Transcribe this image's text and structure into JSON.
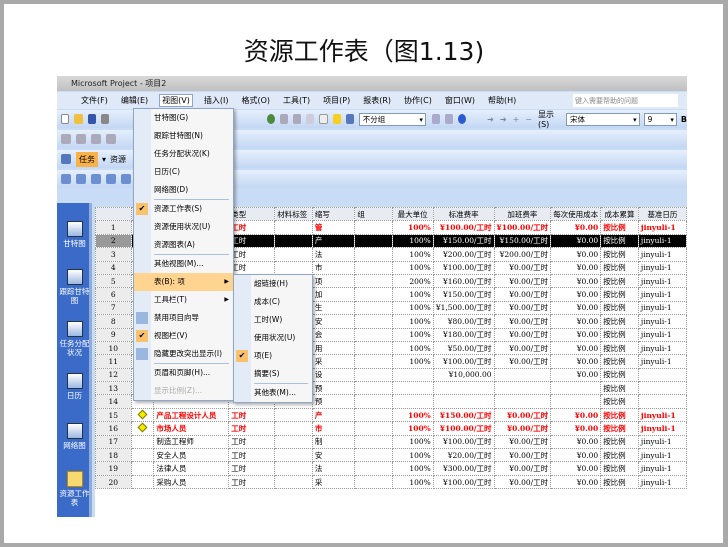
{
  "slide_title": "资源工作表（图1.13)",
  "app": {
    "title": "Microsoft Project - 项目2",
    "help_placeholder": "键入需要帮助的问题"
  },
  "menubar": [
    "文件(F)",
    "编辑(E)",
    "视图(V)",
    "插入(I)",
    "格式(O)",
    "工具(T)",
    "项目(P)",
    "报表(R)",
    "协作(C)",
    "窗口(W)",
    "帮助(H)"
  ],
  "toolbar": {
    "group": "不分组",
    "show": "显示(S)",
    "font": "宋体",
    "size": "9",
    "bold": "B",
    "task": "任务",
    "resource": "资源"
  },
  "viewbar": [
    "甘特图",
    "跟踪甘特图",
    "任务分配状况",
    "日历",
    "网络图",
    "资源工作表"
  ],
  "view_menu": [
    {
      "label": "甘特图(G)"
    },
    {
      "label": "跟踪甘特图(N)"
    },
    {
      "label": "任务分配状况(K)"
    },
    {
      "label": "日历(C)"
    },
    {
      "label": "网络图(D)",
      "sep": true
    },
    {
      "label": "资源工作表(S)",
      "checked": true
    },
    {
      "label": "资源使用状况(U)"
    },
    {
      "label": "资源图表(A)",
      "sep": true
    },
    {
      "label": "其他视图(M)..."
    },
    {
      "label": "表(B): 项",
      "submenu": true,
      "highlight": true
    },
    {
      "label": "工具栏(T)",
      "submenu": true
    },
    {
      "label": "禁用项目向导",
      "icon": true
    },
    {
      "label": "视图栏(V)",
      "checked": true
    },
    {
      "label": "隐藏更改突出显示(I)",
      "icon": true,
      "sep": true
    },
    {
      "label": "页眉和页脚(H)..."
    },
    {
      "label": "显示比例(Z)...",
      "disabled": true
    }
  ],
  "table_submenu": [
    {
      "label": "超链接(H)"
    },
    {
      "label": "成本(C)"
    },
    {
      "label": "工时(W)"
    },
    {
      "label": "使用状况(U)"
    },
    {
      "label": "项(E)",
      "checked": true
    },
    {
      "label": "摘要(S)",
      "sep": true
    },
    {
      "label": "其他表(M)..."
    }
  ],
  "columns": [
    "",
    "",
    "",
    "类型",
    "材料标签",
    "缩写",
    "组",
    "最大单位",
    "标准费率",
    "加班费率",
    "每次使用成本",
    "成本累算",
    "基准日历"
  ],
  "rows": [
    [
      "1",
      "",
      "",
      "工时",
      "",
      "管",
      "",
      "100%",
      "¥100.00/工时",
      "¥100.00/工时",
      "¥0.00",
      "按比例",
      "jinyuli-1"
    ],
    [
      "2",
      "",
      "",
      "工时",
      "",
      "产",
      "",
      "100%",
      "¥150.00/工时",
      "¥150.00/工时",
      "¥0.00",
      "按比例",
      "jinyuli-1"
    ],
    [
      "3",
      "",
      "",
      "工时",
      "",
      "法",
      "",
      "100%",
      "¥200.00/工时",
      "¥200.00/工时",
      "¥0.00",
      "按比例",
      "jinyuli-1"
    ],
    [
      "4",
      "",
      "",
      "工时",
      "",
      "市",
      "",
      "100%",
      "¥100.00/工时",
      "¥0.00/工时",
      "¥0.00",
      "按比例",
      "jinyuli-1"
    ],
    [
      "5",
      "",
      "",
      "",
      "",
      "项",
      "",
      "200%",
      "¥160.00/工时",
      "¥0.00/工时",
      "¥0.00",
      "按比例",
      "jinyuli-1"
    ],
    [
      "6",
      "",
      "",
      "",
      "",
      "加",
      "",
      "100%",
      "¥150.00/工时",
      "¥0.00/工时",
      "¥0.00",
      "按比例",
      "jinyuli-1"
    ],
    [
      "7",
      "",
      "",
      "",
      "",
      "生",
      "",
      "100%",
      "¥1,500.00/工时",
      "¥0.00/工时",
      "¥0.00",
      "按比例",
      "jinyuli-1"
    ],
    [
      "8",
      "",
      "",
      "",
      "",
      "安",
      "",
      "100%",
      "¥80.00/工时",
      "¥0.00/工时",
      "¥0.00",
      "按比例",
      "jinyuli-1"
    ],
    [
      "9",
      "",
      "",
      "",
      "",
      "会",
      "",
      "100%",
      "¥180.00/工时",
      "¥0.00/工时",
      "¥0.00",
      "按比例",
      "jinyuli-1"
    ],
    [
      "10",
      "",
      "",
      "",
      "",
      "用",
      "",
      "100%",
      "¥50.00/工时",
      "¥0.00/工时",
      "¥0.00",
      "按比例",
      "jinyuli-1"
    ],
    [
      "11",
      "",
      "",
      "",
      "",
      "采",
      "",
      "100%",
      "¥100.00/工时",
      "¥0.00/工时",
      "¥0.00",
      "按比例",
      "jinyuli-1"
    ],
    [
      "12",
      "",
      "",
      "",
      "",
      "设",
      "",
      "",
      "¥10,000.00",
      "",
      "¥0.00",
      "按比例",
      ""
    ],
    [
      "13",
      "",
      "",
      "",
      "",
      "预",
      "",
      "",
      "",
      "",
      "",
      "按比例",
      ""
    ],
    [
      "14",
      "",
      "",
      "",
      "",
      "预",
      "",
      "",
      "",
      "",
      "",
      "按比例",
      ""
    ],
    [
      "15",
      "◆",
      "产品工程设计人员",
      "工时",
      "",
      "产",
      "",
      "100%",
      "¥150.00/工时",
      "¥0.00/工时",
      "¥0.00",
      "按比例",
      "jinyuli-1"
    ],
    [
      "16",
      "◆",
      "市场人员",
      "工时",
      "",
      "市",
      "",
      "100%",
      "¥100.00/工时",
      "¥0.00/工时",
      "¥0.00",
      "按比例",
      "jinyuli-1"
    ],
    [
      "17",
      "",
      "制造工程师",
      "工时",
      "",
      "制",
      "",
      "100%",
      "¥100.00/工时",
      "¥0.00/工时",
      "¥0.00",
      "按比例",
      "jinyuli-1"
    ],
    [
      "18",
      "",
      "安全人员",
      "工时",
      "",
      "安",
      "",
      "100%",
      "¥20.00/工时",
      "¥0.00/工时",
      "¥0.00",
      "按比例",
      "jinyuli-1"
    ],
    [
      "19",
      "",
      "法律人员",
      "工时",
      "",
      "法",
      "",
      "100%",
      "¥300.00/工时",
      "¥0.00/工时",
      "¥0.00",
      "按比例",
      "jinyuli-1"
    ],
    [
      "20",
      "",
      "采购人员",
      "工时",
      "",
      "采",
      "",
      "100%",
      "¥100.00/工时",
      "¥0.00/工时",
      "¥0.00",
      "按比例",
      "jinyuli-1"
    ]
  ],
  "red_rows": [
    1,
    15,
    16
  ],
  "selected_row": 2,
  "colors": {
    "highlight": "#ffd390",
    "viewbar": "#3b6bc8",
    "overallocated": "#ff0000"
  }
}
